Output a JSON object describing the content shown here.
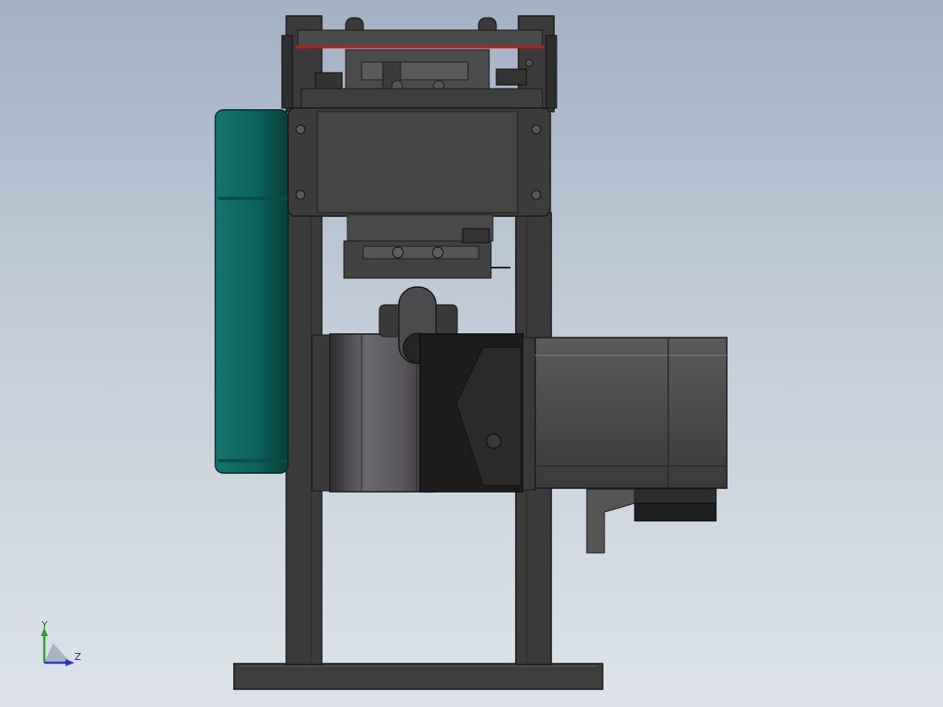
{
  "viewport": {
    "view": "front-view-cad-model",
    "colors": {
      "background_top": "#a3b1c4",
      "background_bottom": "#dde3e9",
      "frame": "#3b3b3b",
      "teal_body": "#0f6a62",
      "motor": "#464646",
      "gearbox": "#565256",
      "belt": "#b02020"
    }
  },
  "triad": {
    "x_label": "Y",
    "y_label": "Z",
    "y_axis_color": "#2ea02e",
    "z_axis_color": "#2a36c8"
  }
}
